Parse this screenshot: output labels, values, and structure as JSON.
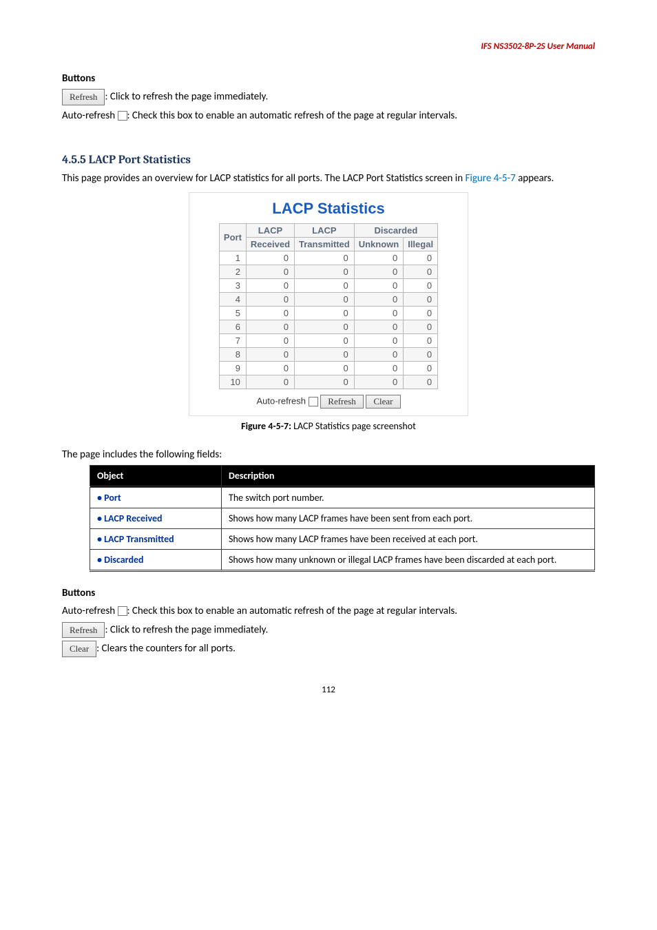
{
  "header": "IFS NS3502-8P-2S  User  Manual",
  "buttons1_title": "Buttons",
  "refresh_label": "Refresh",
  "refresh_desc": ": Click to refresh the page immediately.",
  "autorefresh_pre": "Auto-refresh ",
  "autorefresh_desc": ": Check this box to enable an automatic refresh of the page at regular intervals.",
  "h3": "4.5.5 LACP Port Statistics",
  "intro_pre": "This page provides an overview for LACP statistics for all ports. The LACP Port Statistics screen in ",
  "intro_fig": "Figure 4-5-7",
  "intro_post": " appears.",
  "lacp": {
    "title": "LACP Statistics",
    "col_port": "Port",
    "col_recv": "LACP",
    "col_recv2": "Received",
    "col_tx": "LACP",
    "col_tx2": "Transmitted",
    "col_disc": "Discarded",
    "col_unk": "Unknown",
    "col_ill": "Illegal",
    "footer_auto": "Auto-refresh",
    "footer_refresh": "Refresh",
    "footer_clear": "Clear"
  },
  "chart_data": {
    "type": "table",
    "columns": [
      "Port",
      "LACP Received",
      "LACP Transmitted",
      "Discarded Unknown",
      "Discarded Illegal"
    ],
    "rows": [
      [
        1,
        0,
        0,
        0,
        0
      ],
      [
        2,
        0,
        0,
        0,
        0
      ],
      [
        3,
        0,
        0,
        0,
        0
      ],
      [
        4,
        0,
        0,
        0,
        0
      ],
      [
        5,
        0,
        0,
        0,
        0
      ],
      [
        6,
        0,
        0,
        0,
        0
      ],
      [
        7,
        0,
        0,
        0,
        0
      ],
      [
        8,
        0,
        0,
        0,
        0
      ],
      [
        9,
        0,
        0,
        0,
        0
      ],
      [
        10,
        0,
        0,
        0,
        0
      ]
    ]
  },
  "figcap_b": "Figure 4-5-7:",
  "figcap": " LACP Statistics page screenshot",
  "fields_intro": "The page includes the following fields:",
  "fields_th1": "Object",
  "fields_th2": "Description",
  "fields": [
    {
      "obj": "• Port",
      "desc": "The switch port number."
    },
    {
      "obj": "• LACP Received",
      "desc": "Shows how many LACP frames have been sent from each port."
    },
    {
      "obj": "• LACP Transmitted",
      "desc": "Shows how many LACP frames have been received at each port."
    },
    {
      "obj": "• Discarded",
      "desc": "Shows how many unknown or illegal LACP frames have been discarded at each port."
    }
  ],
  "buttons2_title": "Buttons",
  "auto2_pre": "Auto-refresh ",
  "auto2_desc": ": Check this box to enable an automatic refresh of the page at regular intervals.",
  "refresh2_desc": ": Click to refresh the page immediately.",
  "clear_label": "Clear",
  "clear_desc": ": Clears the counters for all ports.",
  "page_num": "112"
}
